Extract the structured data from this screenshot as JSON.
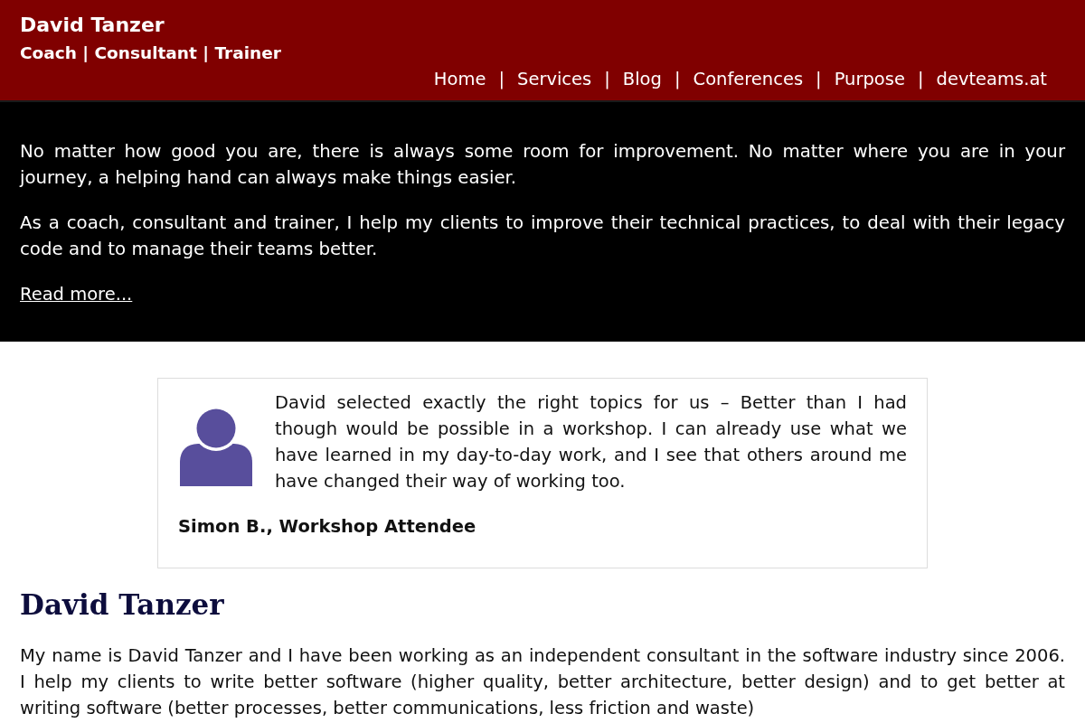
{
  "header": {
    "title": "David Tanzer",
    "subtitle": "Coach | Consultant | Trainer",
    "nav": [
      {
        "kind": "link",
        "label": "Home"
      },
      {
        "kind": "separator",
        "label": "|"
      },
      {
        "kind": "link",
        "label": "Services"
      },
      {
        "kind": "separator",
        "label": "|"
      },
      {
        "kind": "link",
        "label": "Blog"
      },
      {
        "kind": "separator",
        "label": "|"
      },
      {
        "kind": "link",
        "label": "Conferences"
      },
      {
        "kind": "separator",
        "label": "|"
      },
      {
        "kind": "link",
        "label": "Purpose"
      },
      {
        "kind": "separator",
        "label": "|"
      },
      {
        "kind": "link",
        "label": "devteams.at"
      }
    ]
  },
  "intro": {
    "paragraphs": [
      "No matter how good you are, there is always some room for improvement. No matter where you are in your journey, a helping hand can always make things easier.",
      "As a coach, consultant and trainer, I help my clients to improve their technical practices, to deal with their legacy code and to manage their teams better."
    ],
    "link": "Read more..."
  },
  "testimonial": {
    "quote": "David selected exactly the right topics for us – Better than I had though would be possible in a workshop. I can already use what we have learned in my day-to-day work, and I see that others around me have changed their way of working too.",
    "author": "Simon B., Workshop Attendee"
  },
  "about": {
    "heading": "David Tanzer",
    "paragraph": "My name is David Tanzer and I have been working as an independent consultant in the software industry since 2006. I help my clients to write better software (higher quality, better architecture, better design) and to get better at writing software (better processes, better communications, less friction and waste)"
  }
}
